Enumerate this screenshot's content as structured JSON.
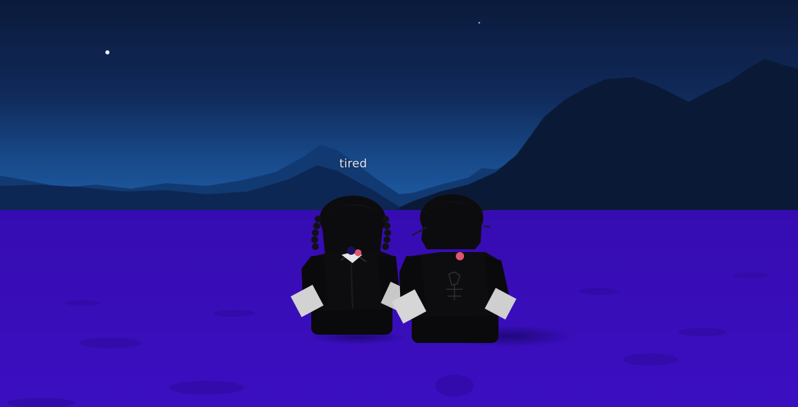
{
  "scene": {
    "type": "3d-game-viewport",
    "time_of_day": "night",
    "colors": {
      "sky_top": "#0c1c3e",
      "sky_horizon": "#1c5aa0",
      "mountains_far": "#0f3466",
      "mountains_near": "#0a1831",
      "ground": "#3a0cbc",
      "ground_shadow": "#2c0898",
      "avatar_body": "#0b0b0d",
      "avatar_hands": "#d4d4d4",
      "accent_bow": "#e0566c"
    }
  },
  "chat": {
    "bubble_text": "tired"
  },
  "avatars": [
    {
      "id": "left-avatar",
      "hair": "braided",
      "pose": "sitting"
    },
    {
      "id": "right-avatar",
      "hair": "short",
      "pose": "sitting"
    }
  ]
}
